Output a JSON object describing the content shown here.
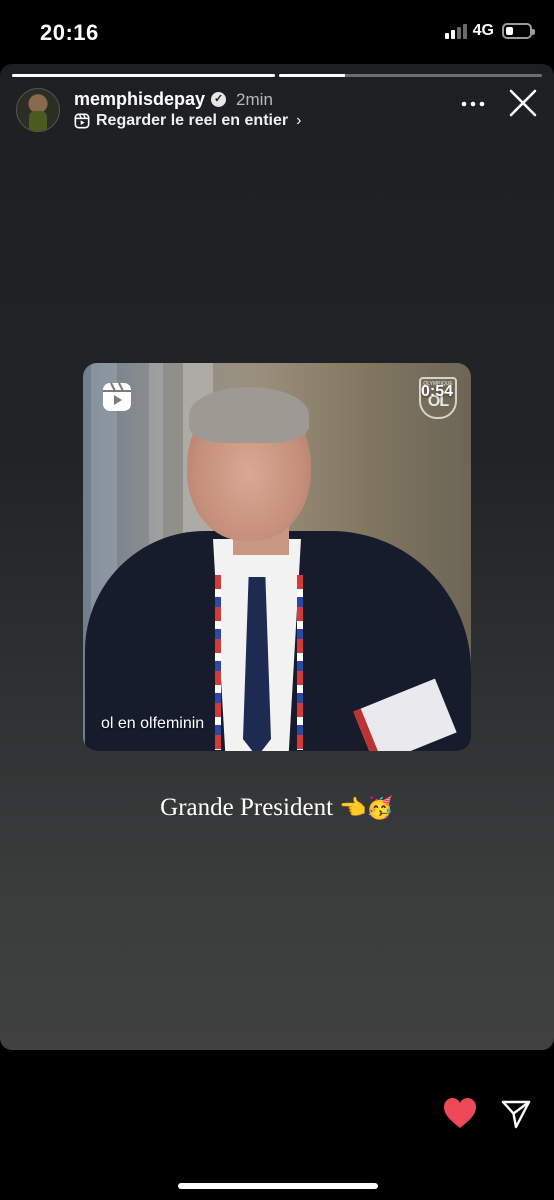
{
  "status_bar": {
    "time": "20:16",
    "network": "4G",
    "signal_bars_active": 2,
    "battery_level": 0.3
  },
  "story": {
    "progress_segments": [
      1.0,
      0.25
    ],
    "username": "memphisdepay",
    "verified": true,
    "time_ago": "2min",
    "reel_link_label": "Regarder le reel en entier",
    "more_icon": "more-horizontal-icon",
    "close_icon": "close-icon"
  },
  "reel": {
    "duration": "0:54",
    "caption": "ol en olfeminin",
    "logo_top_text": "OLYMPIQUE",
    "logo_text": "OL"
  },
  "caption": {
    "text": "Grande President",
    "emoji": "👈🥳"
  },
  "actions": {
    "like_icon": "heart-icon",
    "like_color": "#ed4956",
    "share_icon": "send-icon"
  }
}
